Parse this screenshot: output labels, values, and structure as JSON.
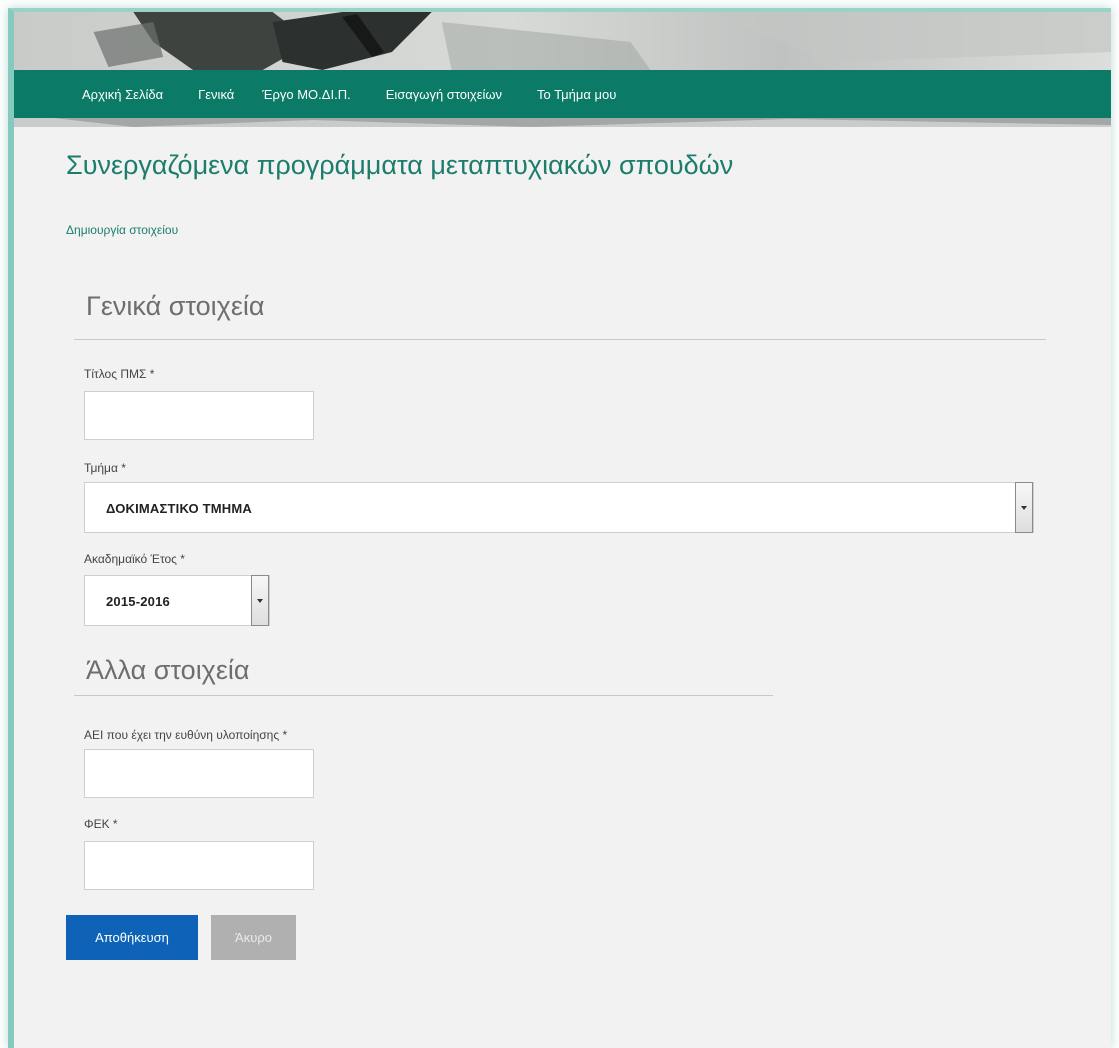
{
  "nav": {
    "items": [
      {
        "label": "Αρχική Σελίδα"
      },
      {
        "label": "Γενικά"
      },
      {
        "label": "Έργο ΜΟ.ΔΙ.Π."
      },
      {
        "label": "Εισαγωγή στοιχείων"
      },
      {
        "label": "Το Τμήμα μου"
      }
    ]
  },
  "page": {
    "title": "Συνεργαζόμενα προγράμματα μεταπτυχιακών σπουδών",
    "subtitle": "Δημιουργία στοιχείου"
  },
  "sections": {
    "general": {
      "title": "Γενικά στοιχεία"
    },
    "other": {
      "title": "Άλλα στοιχεία"
    }
  },
  "fields": {
    "pms_title": {
      "label": "Τίτλος ΠΜΣ *",
      "value": ""
    },
    "department": {
      "label": "Τμήμα *",
      "selected": "ΔΟΚΙΜΑΣΤΙΚΟ ΤΜΗΜΑ"
    },
    "academic_year": {
      "label": "Ακαδημαϊκό Έτος *",
      "selected": "2015-2016"
    },
    "institution": {
      "label": "ΑΕΙ που έχει την ευθύνη υλοποίησης *",
      "value": ""
    },
    "fek": {
      "label": "ΦΕΚ *",
      "value": ""
    }
  },
  "buttons": {
    "save": "Αποθήκευση",
    "cancel": "Άκυρο"
  },
  "colors": {
    "nav_bg": "#0b7a66",
    "title": "#1c7d6d",
    "save_button": "#0e63b8",
    "cancel_button": "#b0b0b0"
  }
}
